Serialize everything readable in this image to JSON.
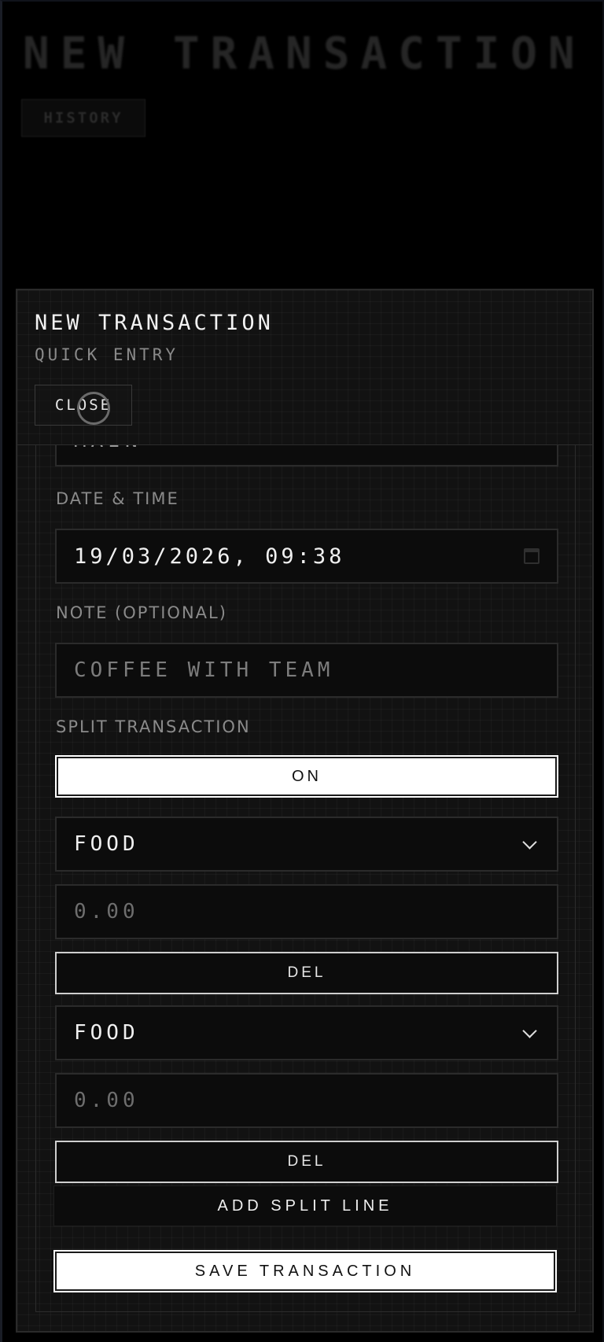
{
  "background": {
    "title": "NEW TRANSACTION",
    "history_label": "HISTORY"
  },
  "modal": {
    "title": "NEW TRANSACTION",
    "subtitle": "QUICK ENTRY",
    "close_label": "CLOSE"
  },
  "form": {
    "cutoff_value": "MAIN",
    "date_label": "DATE & TIME",
    "date_value": "19/03/2026, 09:38",
    "note_label": "NOTE (OPTIONAL)",
    "note_placeholder": "COFFEE WITH TEAM",
    "split_label": "SPLIT TRANSACTION",
    "split_toggle": "ON",
    "split_lines": [
      {
        "category": "FOOD",
        "amount_placeholder": "0.00",
        "delete_label": "DEL"
      },
      {
        "category": "FOOD",
        "amount_placeholder": "0.00",
        "delete_label": "DEL"
      }
    ],
    "add_split_label": "ADD SPLIT LINE",
    "save_label": "SAVE TRANSACTION"
  },
  "icons": {
    "date": "calendar-icon",
    "select": "chevron-down-icon"
  },
  "colors": {
    "background": "#000000",
    "panel": "#121212",
    "field": "#0c0c0c",
    "primary_button": "#ffffff",
    "muted_text": "#8a8a8a"
  }
}
